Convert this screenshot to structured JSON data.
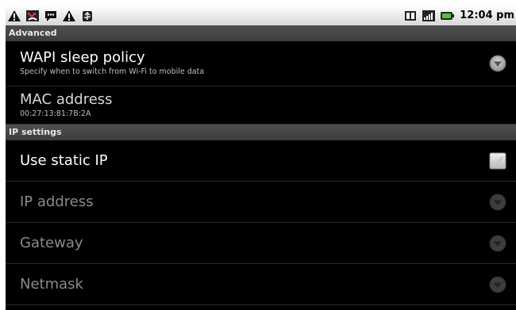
{
  "statusbar": {
    "left_icons": [
      "warning-icon",
      "missed-call-icon",
      "sms-icon",
      "warning-icon",
      "usb-debug-icon"
    ],
    "right_icons": [
      "data-connection-icon",
      "signal-icon",
      "battery-icon"
    ],
    "time": "12:04 pm"
  },
  "sections": {
    "advanced": "Advanced",
    "ip_settings": "IP settings"
  },
  "prefs": {
    "wapi_sleep": {
      "title": "WAPI sleep policy",
      "summary": "Specify when to switch from Wi-Fi to mobile data",
      "control": "dropdown-arrow-icon"
    },
    "mac": {
      "title": "MAC address",
      "value": "00:27:13:81:7B:2A"
    },
    "static_ip": {
      "title": "Use static IP",
      "checked": false,
      "control": "checkbox"
    },
    "ip_address": {
      "title": "IP address",
      "enabled": false
    },
    "gateway": {
      "title": "Gateway",
      "enabled": false
    },
    "netmask": {
      "title": "Netmask",
      "enabled": false
    }
  },
  "colors": {
    "background": "#000000",
    "section_header": "#444444",
    "text_primary": "#ffffff",
    "text_disabled": "#8a8a8a"
  }
}
